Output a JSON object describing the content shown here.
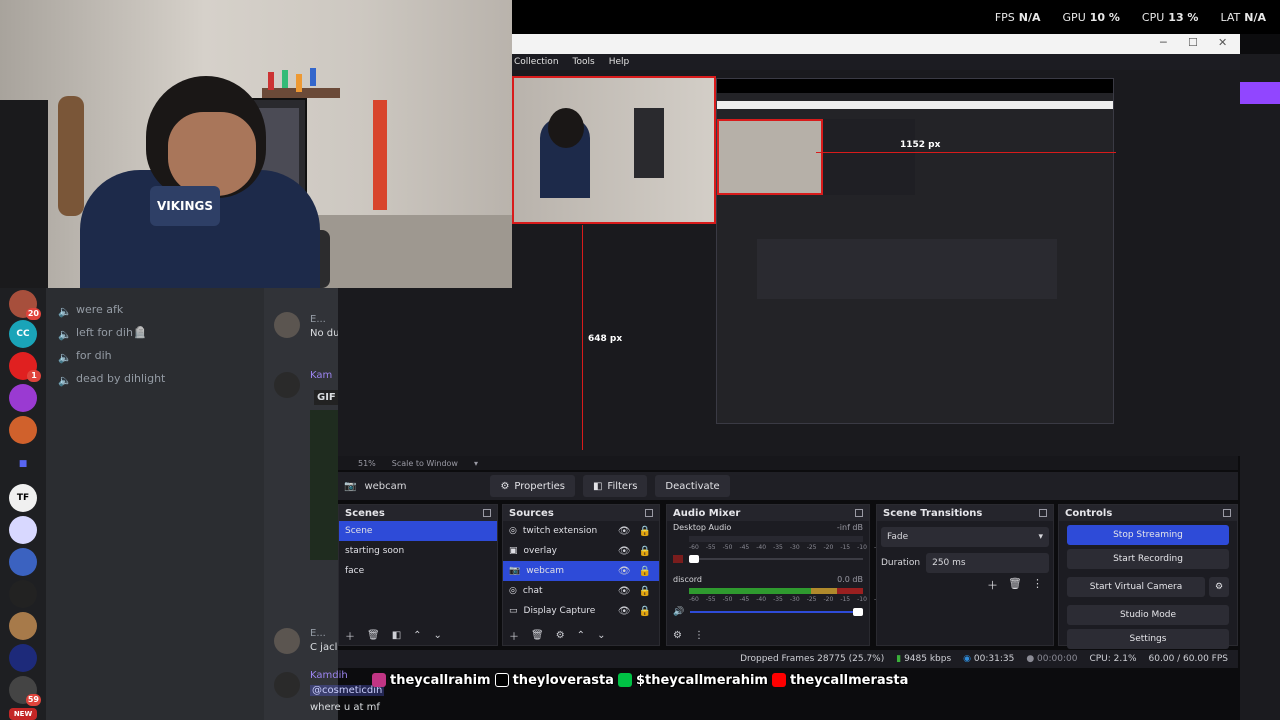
{
  "perf": [
    {
      "label": "FPS",
      "value": "N/A"
    },
    {
      "label": "GPU",
      "value": "10 %"
    },
    {
      "label": "CPU",
      "value": "13 %"
    },
    {
      "label": "LAT",
      "value": "N/A"
    }
  ],
  "webcam": {
    "shirt_text": "VIKINGS"
  },
  "discord": {
    "servers": [
      {
        "name": "server-1",
        "badge": "20",
        "color": "#a74f3c"
      },
      {
        "name": "server-cc",
        "label": "CC",
        "color": "#1aa4b8"
      },
      {
        "name": "youtube",
        "badge": "1",
        "color": "#e02020"
      },
      {
        "name": "server-4",
        "color": "#9a3ad2"
      },
      {
        "name": "server-5",
        "color": "#d0612c"
      },
      {
        "name": "server-6",
        "color": "#5865f2"
      },
      {
        "name": "server-7",
        "color": "#f0f0f0"
      },
      {
        "name": "server-8",
        "color": "#d8d8ff"
      },
      {
        "name": "server-9",
        "color": "#3b62c0"
      },
      {
        "name": "server-10",
        "color": "#222"
      },
      {
        "name": "server-11",
        "color": "#a77a4a"
      },
      {
        "name": "server-12",
        "color": "#1d2a7a"
      },
      {
        "name": "server-13",
        "badge": "59",
        "color": "#444"
      },
      {
        "name": "server-14",
        "label": "NEW",
        "color": "#c42626"
      }
    ],
    "channels": [
      "were afk",
      "left for dih🪦",
      "for dih",
      "dead by dihlight"
    ],
    "chat": {
      "msg1_user": "E...",
      "msg1_text": "No du",
      "msg2_user": "Kam",
      "msg2_gif": "GIF",
      "msg3_user": "E...",
      "msg3_text": "C jacl",
      "msg4_user": "Kamdih",
      "msg4_mention": "@cosmeticdih",
      "msg4_text": "where u at mf"
    }
  },
  "obs": {
    "menu": [
      "Collection",
      "Tools",
      "Help"
    ],
    "annotations": {
      "width": "1152 px",
      "height": "648 px"
    },
    "zoom": "51%",
    "scale_mode": "Scale to Window",
    "selected_source": "webcam",
    "src_buttons": {
      "properties": "Properties",
      "filters": "Filters",
      "deactivate": "Deactivate"
    },
    "docks": {
      "scenes": "Scenes",
      "sources": "Sources",
      "mixer": "Audio Mixer",
      "transitions": "Scene Transitions",
      "controls": "Controls"
    },
    "scenes": [
      "Scene",
      "starting soon",
      "face"
    ],
    "sources": [
      "twitch extension",
      "overlay",
      "webcam",
      "chat",
      "Display Capture"
    ],
    "mixer": [
      {
        "name": "Desktop Audio",
        "db": "-inf dB",
        "level": 0
      },
      {
        "name": "discord",
        "db": "0.0 dB",
        "level": 1
      }
    ],
    "meter_ticks": [
      "-60",
      "-55",
      "-50",
      "-45",
      "-40",
      "-35",
      "-30",
      "-25",
      "-20",
      "-15",
      "-10",
      "-5",
      "0"
    ],
    "transition": {
      "type": "Fade",
      "duration_label": "Duration",
      "duration": "250 ms"
    },
    "controls": [
      "Stop Streaming",
      "Start Recording",
      "Start Virtual Camera",
      "Studio Mode",
      "Settings"
    ],
    "status": {
      "dropped": "Dropped Frames 28775 (25.7%)",
      "bitrate": "9485 kbps",
      "live_time": "00:31:35",
      "rec_time": "00:00:00",
      "cpu": "CPU: 2.1%",
      "fps": "60.00 / 60.00 FPS"
    }
  },
  "socials": [
    {
      "platform": "instagram-icon",
      "handle": "theycallrahim",
      "color": "#c13584"
    },
    {
      "platform": "x-icon",
      "handle": "theyloverasta",
      "color": "#000"
    },
    {
      "platform": "cashapp-icon",
      "handle": "$theycallmerahim",
      "color": "#00c244"
    },
    {
      "platform": "youtube-icon",
      "handle": "theycallmerasta",
      "color": "#ff0000"
    }
  ]
}
